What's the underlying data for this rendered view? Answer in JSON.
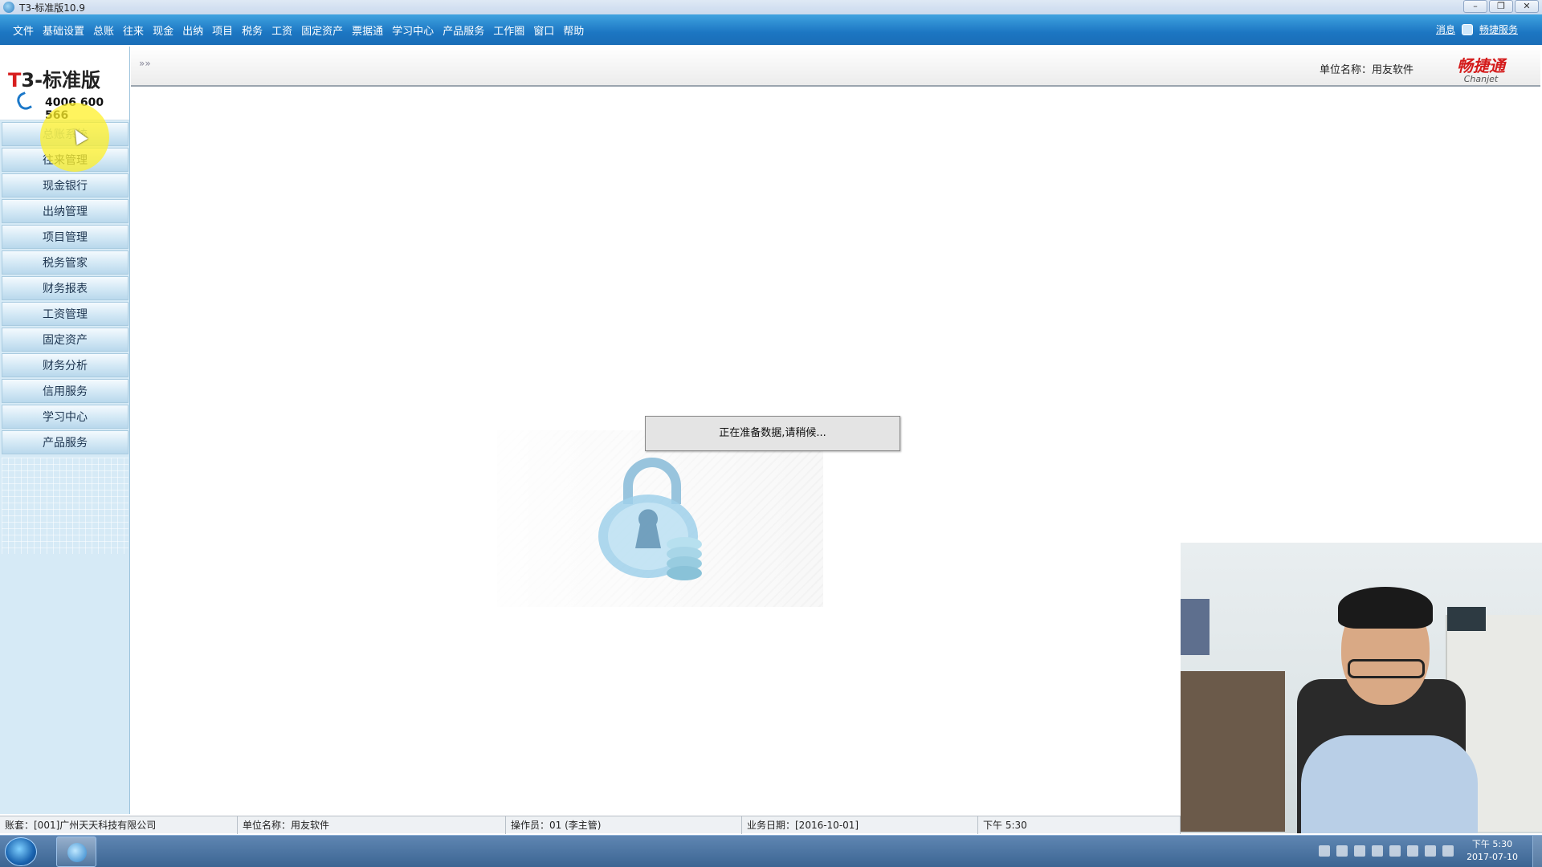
{
  "window": {
    "title": "T3-标准版10.9",
    "controls": [
      "–",
      "❐",
      "✕"
    ]
  },
  "menu": {
    "items": [
      "文件",
      "基础设置",
      "总账",
      "往来",
      "现金",
      "出纳",
      "项目",
      "税务",
      "工资",
      "固定资产",
      "票据通",
      "学习中心",
      "产品服务",
      "工作圈",
      "窗口",
      "帮助"
    ],
    "message_link": "消息",
    "service_link": "畅捷服务"
  },
  "sidebar": {
    "logo_text": "T3-标准版",
    "phone": "4006 600 566",
    "nav_items": [
      "总账系统",
      "往来管理",
      "现金银行",
      "出纳管理",
      "项目管理",
      "税务管家",
      "财务报表",
      "工资管理",
      "固定资产",
      "财务分析",
      "信用服务",
      "学习中心",
      "产品服务"
    ],
    "active_index": 0
  },
  "header": {
    "collapse_glyph": "»»",
    "unit_label": "单位名称：用友软件",
    "brand_cn": "畅捷通",
    "brand_en": "Chanjet"
  },
  "dialog": {
    "message": "正在准备数据,请稍候..."
  },
  "statusbar": {
    "account": "账套：[001]广州天天科技有限公司",
    "unit": "单位名称：用友软件",
    "operator": "操作员：01 (李主管)",
    "business_date": "业务日期：[2016-10-01]",
    "time": "下午 5:30"
  },
  "taskbar": {
    "clock_time": "下午 5:30",
    "clock_date": "2017-07-10"
  },
  "colors": {
    "menubar": "#1c76c2",
    "sidebar": "#d6eaf6",
    "brand_red": "#d41b1b"
  },
  "icons": [
    "app-icon",
    "start-icon",
    "lock-icon",
    "phone-icon",
    "service-icon"
  ]
}
